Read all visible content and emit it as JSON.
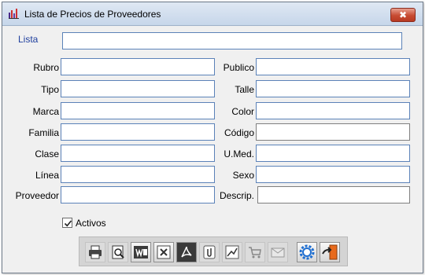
{
  "window": {
    "title": "Lista de Precios de Proveedores",
    "close_glyph": "✖"
  },
  "lista": {
    "label": "Lista",
    "value": ""
  },
  "left_fields": [
    {
      "label": "Rubro",
      "value": ""
    },
    {
      "label": "Tipo",
      "value": ""
    },
    {
      "label": "Marca",
      "value": ""
    },
    {
      "label": "Familia",
      "value": ""
    },
    {
      "label": "Clase",
      "value": ""
    },
    {
      "label": "Línea",
      "value": ""
    },
    {
      "label": "Proveedor",
      "value": ""
    }
  ],
  "right_fields": [
    {
      "label": "Publico",
      "value": ""
    },
    {
      "label": "Talle",
      "value": ""
    },
    {
      "label": "Color",
      "value": ""
    },
    {
      "label": "Código",
      "value": ""
    },
    {
      "label": "U.Med.",
      "value": ""
    },
    {
      "label": "Sexo",
      "value": ""
    },
    {
      "label": "Descrip.",
      "value": ""
    }
  ],
  "activos": {
    "label": "Activos",
    "checked": true
  },
  "toolbar": {
    "buttons": [
      "print-icon",
      "preview-icon",
      "word-icon",
      "excel-icon",
      "pdf-icon",
      "clip-icon",
      "chart-icon",
      "cart-icon",
      "mail-icon",
      "settings-icon",
      "exit-icon"
    ]
  },
  "colors": {
    "label_accent": "#1f3f9e",
    "input_border": "#5b82b8",
    "close_red": "#c74b32"
  }
}
